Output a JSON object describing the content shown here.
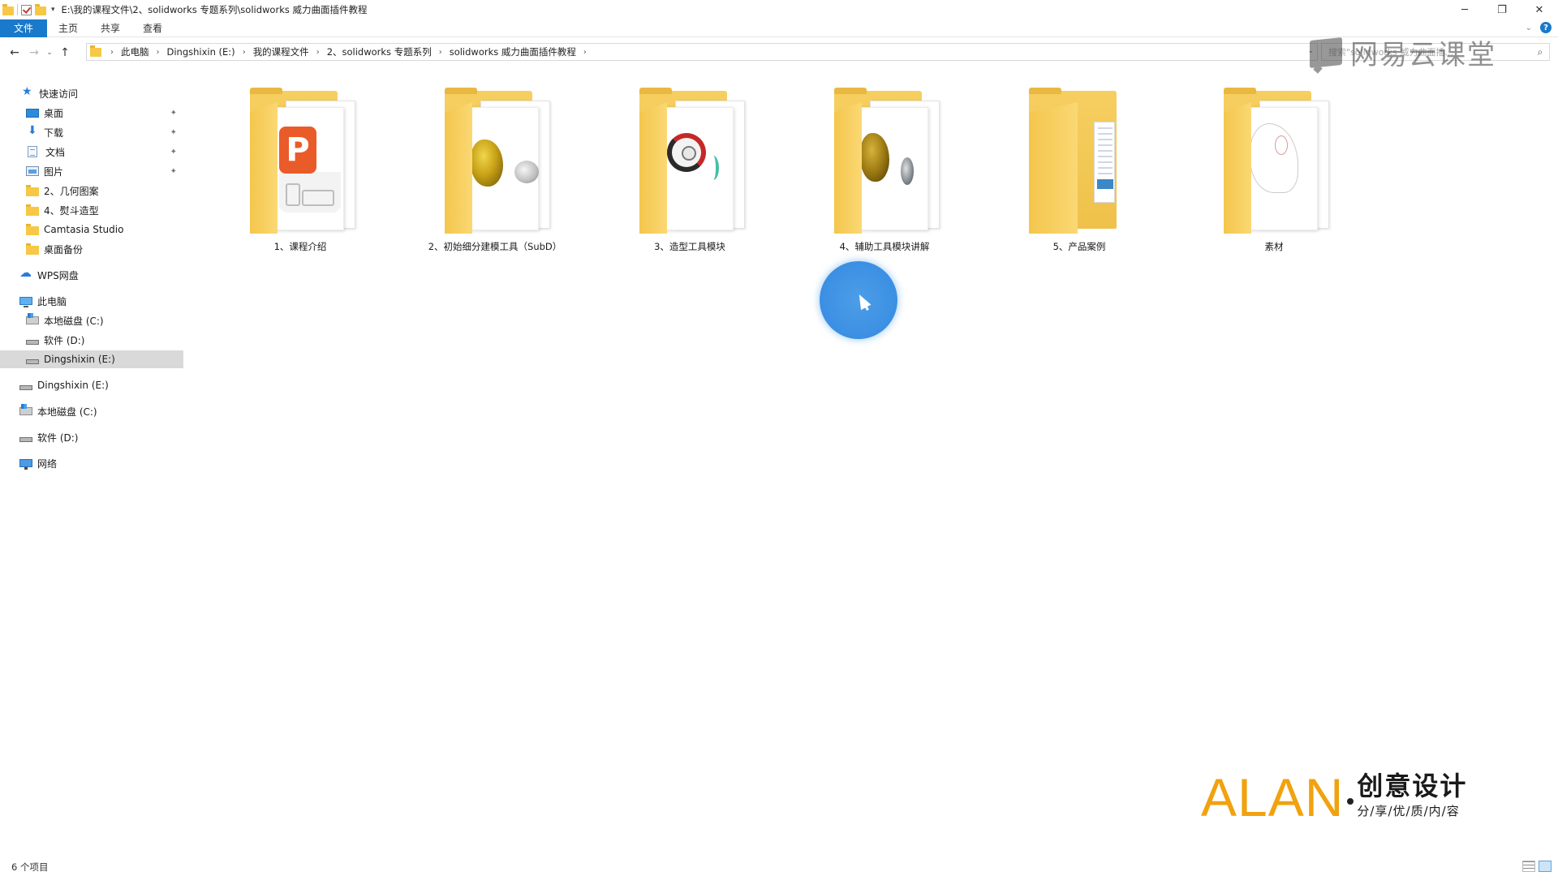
{
  "window": {
    "title": "E:\\我的课程文件\\2、solidworks 专题系列\\solidworks 威力曲面插件教程",
    "controls": {
      "minimize": "─",
      "restore": "❐",
      "close": "✕"
    }
  },
  "ribbon": {
    "tabs": [
      "文件",
      "主页",
      "共享",
      "查看"
    ],
    "help": "?"
  },
  "nav": {
    "back": "←",
    "forward": "→",
    "recent": "⌄",
    "up": "↑",
    "breadcrumb": [
      "此电脑",
      "Dingshixin (E:)",
      "我的课程文件",
      "2、solidworks 专题系列",
      "solidworks 威力曲面插件教程"
    ],
    "search_placeholder": "搜索\"solidworks 威力曲面插...",
    "search_icon": "⌕"
  },
  "sidebar": {
    "items": [
      {
        "label": "快速访问",
        "icon": "star-icon",
        "pinned": false,
        "selected": false
      },
      {
        "label": "桌面",
        "icon": "desktop-icon",
        "pinned": true,
        "selected": false
      },
      {
        "label": "下载",
        "icon": "download-icon",
        "pinned": true,
        "selected": false
      },
      {
        "label": "文档",
        "icon": "document-icon",
        "pinned": true,
        "selected": false
      },
      {
        "label": "图片",
        "icon": "picture-icon",
        "pinned": true,
        "selected": false
      },
      {
        "label": "2、几何图案",
        "icon": "folder-icon",
        "pinned": false,
        "selected": false
      },
      {
        "label": "4、熨斗造型",
        "icon": "folder-icon",
        "pinned": false,
        "selected": false
      },
      {
        "label": "Camtasia Studio",
        "icon": "folder-icon",
        "pinned": false,
        "selected": false
      },
      {
        "label": "桌面备份",
        "icon": "folder-icon",
        "pinned": false,
        "selected": false
      },
      {
        "label": "WPS网盘",
        "icon": "cloud-icon",
        "pinned": false,
        "selected": false
      },
      {
        "label": "此电脑",
        "icon": "computer-icon",
        "pinned": false,
        "selected": false
      },
      {
        "label": "本地磁盘 (C:)",
        "icon": "windows-drive-icon",
        "pinned": false,
        "selected": false
      },
      {
        "label": "软件 (D:)",
        "icon": "drive-icon",
        "pinned": false,
        "selected": false
      },
      {
        "label": "Dingshixin (E:)",
        "icon": "drive-icon",
        "pinned": false,
        "selected": true
      },
      {
        "label": "Dingshixin (E:)",
        "icon": "drive-icon",
        "pinned": false,
        "selected": false
      },
      {
        "label": "本地磁盘 (C:)",
        "icon": "windows-drive-icon",
        "pinned": false,
        "selected": false
      },
      {
        "label": "软件 (D:)",
        "icon": "drive-icon",
        "pinned": false,
        "selected": false
      },
      {
        "label": "网络",
        "icon": "network-icon",
        "pinned": false,
        "selected": false
      }
    ],
    "pin_glyph": "📌"
  },
  "folders": [
    {
      "label": "1、课程介绍",
      "thumb": "powerpoint-icon",
      "ppt_letter": "P"
    },
    {
      "label": "2、初始细分建模工具（SubD）",
      "thumb": "gold-model-thumbnail"
    },
    {
      "label": "3、造型工具模块",
      "thumb": "steering-wheel-thumbnail"
    },
    {
      "label": "4、辅助工具模块讲解",
      "thumb": "gold-model-thumbnail"
    },
    {
      "label": "5、产品案例",
      "thumb": "document-thumbnail"
    },
    {
      "label": "素材",
      "thumb": "sketch-thumbnail"
    }
  ],
  "watermarks": {
    "top": "网易云课堂",
    "bottom_brand": "ALAN",
    "bottom_cn": "创意设计",
    "bottom_tagline": "分/享/优/质/内/容"
  },
  "status": {
    "item_count": "6 个项目"
  },
  "colors": {
    "accent": "#1979ca",
    "folder": "#f7c846",
    "brand_orange": "#f1a20f",
    "cursor_highlight": "#3b8fe3"
  }
}
